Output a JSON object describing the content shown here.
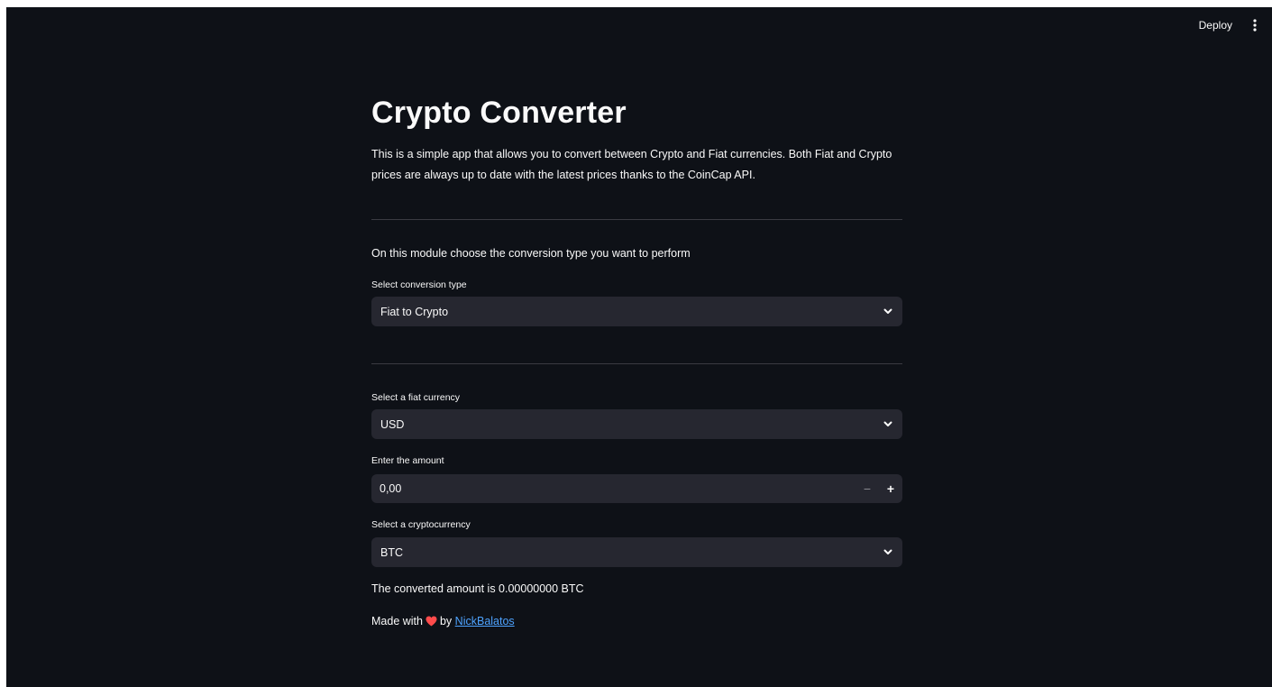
{
  "toolbar": {
    "deploy_label": "Deploy",
    "menu_icon": "vertical-dots-icon"
  },
  "header": {
    "title": "Crypto Converter",
    "intro_line1": "This is a simple app that allows you to convert between Crypto and Fiat currencies. Both Fiat and Crypto",
    "intro_line2": "prices are always up to date with the latest prices thanks to the CoinCap API."
  },
  "conversion": {
    "module_text": "On this module choose the conversion type you want to perform",
    "label": "Select conversion type",
    "value": "Fiat to Crypto"
  },
  "fiat": {
    "label": "Select a fiat currency",
    "value": "USD"
  },
  "amount": {
    "label": "Enter the amount",
    "value": "0,00",
    "minus": "−",
    "plus": "+"
  },
  "crypto": {
    "label": "Select a cryptocurrency",
    "value": "BTC"
  },
  "result": {
    "text": "The converted amount is 0.00000000 BTC"
  },
  "footer": {
    "made_with": "Made with",
    "by": "by",
    "author_link": "NickBalatos",
    "heart_icon": "heart-icon",
    "heart_color": "#ff4b4b"
  },
  "colors": {
    "background": "#0e1117",
    "input_bg": "#262730",
    "text": "#fafafa",
    "link": "#4ea3ff"
  }
}
